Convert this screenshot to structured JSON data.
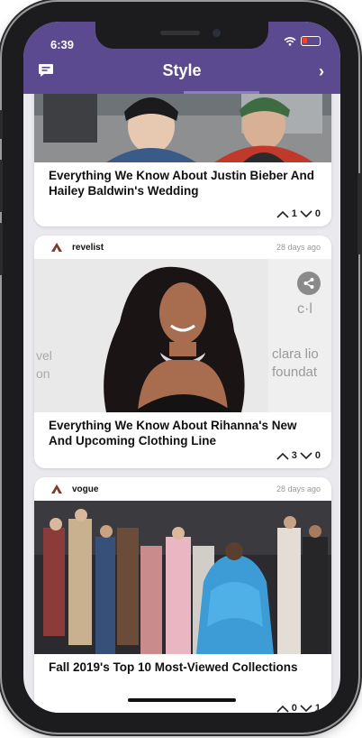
{
  "status_bar": {
    "time": "6:39"
  },
  "header": {
    "title": "Style"
  },
  "cards": [
    {
      "headline": "Everything We Know About Justin Bieber And Hailey Baldwin's Wedding",
      "upvotes": "1",
      "downvotes": "0"
    },
    {
      "source": "revelist",
      "time_ago": "28 days ago",
      "headline": "Everything We Know About Rihanna's New And Upcoming Clothing Line",
      "upvotes": "3",
      "downvotes": "0",
      "backdrop_text": [
        "c·l",
        "clara lio",
        "foundat",
        "vel",
        "on"
      ]
    },
    {
      "source": "vogue",
      "time_ago": "28 days ago",
      "headline": "Fall 2019's Top 10 Most-Viewed Collections",
      "upvotes": "0",
      "downvotes": "1"
    }
  ],
  "colors": {
    "accent": "#5b4a8f",
    "battery_low": "#ff3b30",
    "logo": "#7a3b2e"
  },
  "icons": [
    "feedback-icon",
    "chevron-right-icon",
    "share-icon",
    "upvote-icon",
    "downvote-icon",
    "wifi-icon",
    "battery-icon"
  ]
}
